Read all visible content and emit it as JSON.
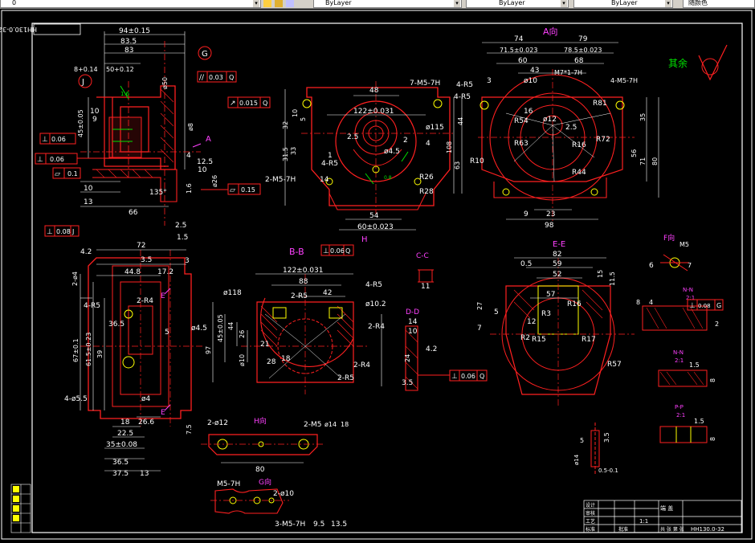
{
  "toolbar": {
    "layer_value": "0",
    "color_value": "ByLayer",
    "linetype_value": "ByLayer",
    "lineweight_value": "ByLayer",
    "plotstyle_value": "随颜色"
  },
  "colors": {
    "bg": "#000000",
    "outline": "#ff2020",
    "dim": "#ffffff",
    "center": "#ff3030",
    "green": "#00e000",
    "yellow": "#ffff00",
    "magenta": "#ff40ff",
    "hatch": "#ff2020"
  },
  "drawing": {
    "part_no_mirror": "HH130.0-32",
    "view_a": "A向",
    "view_b": "B-B",
    "view_cc": "C-C",
    "view_dd": "D-D",
    "view_ee": "E-E",
    "view_f": "F向",
    "view_h": "H向",
    "view_g": "G向",
    "view_nn": "N-N",
    "view_nn2": "N-N",
    "view_pp": "P-P",
    "scale_21a": "2:1",
    "scale_21b": "2:1",
    "scale_21c": "2:1",
    "qiyu": "其余",
    "tv": {
      "d1": "94±0.15",
      "d2": "83.5",
      "d3": "83",
      "d4": "8+0.14",
      "d5": "50+0.12",
      "d6": "10",
      "d7": "45±0.05",
      "d8": "9",
      "d9": "12.5",
      "d10": "4",
      "d11": "10",
      "d12": "13",
      "d13": "66",
      "d14": "135°",
      "d15": "1.6",
      "d16": "2.5",
      "d17": "1.5",
      "d18": "ø26",
      "d19": "ø50",
      "d20": "ø8",
      "d21": "10",
      "t1": "0.06",
      "t2": "0.06",
      "t3": "0.1",
      "t4": "0.03",
      "t5": "0.015",
      "t6": "0.15",
      "lbl_q": "Q",
      "lbl_j": "J",
      "lbl_g": "G",
      "lbl_a": "A"
    },
    "fv": {
      "d1": "48",
      "d2": "7-M5-7H",
      "d3": "4-R5",
      "d4": "122±0.031",
      "d5": "10",
      "d6": "5",
      "d7": "32",
      "d8": "31.5",
      "d9": "33",
      "d10": "ø115",
      "d11": "2.5",
      "d12": "ø4.5",
      "d13": "2",
      "d14": "4",
      "d15": "R26",
      "d16": "R28",
      "d17": "2-M5-7H",
      "d18": "54",
      "d19": "60±0.023",
      "d20": "14",
      "d21": "1",
      "d22": "4-R5"
    },
    "av": {
      "d1": "74",
      "d2": "79",
      "d3": "71.5±0.023",
      "d4": "78.5±0.023",
      "d5": "60",
      "d6": "68",
      "d7": "43",
      "d8": "ø10",
      "d9": "M7*1-7H",
      "d10": "4-R5",
      "d11": "4-M5-7H",
      "d12": "R81",
      "d13": "R54",
      "d14": "R63",
      "d15": "R16",
      "d16": "R72",
      "d17": "R10",
      "d18": "R44",
      "d19": "44",
      "d20": "108",
      "d21": "63",
      "d22": "56",
      "d23": "71",
      "d24": "80",
      "d25": "35",
      "d26": "23",
      "d27": "98",
      "d28": "9",
      "d29": "16",
      "d30": "ø12",
      "d31": "2.5",
      "d32": "3"
    },
    "bb": {
      "d1": "122±0.031",
      "d2": "88",
      "d3": "42",
      "d4": "2-R5",
      "d5": "4-R5",
      "d6": "ø118",
      "d7": "ø10.2",
      "d8": "45±0.05",
      "d9": "44",
      "d10": "26",
      "d11": "97",
      "d12": "21",
      "d13": "ø10",
      "d14": "28",
      "d15": "18",
      "d16": "2-R4",
      "d17": "2-R4",
      "d18": "2-R5",
      "d19": "0.06",
      "d20": "Q",
      "d21": "H"
    },
    "cc": {
      "d1": "11"
    },
    "dd": {
      "d1": "14",
      "d2": "10",
      "d3": "24",
      "d4": "4.2",
      "d5": "3.5",
      "d6": "0.06",
      "d7": "Q"
    },
    "ee": {
      "d1": "82",
      "d2": "59",
      "d3": "52",
      "d4": "0.5",
      "d5": "57",
      "d6": "R16",
      "d7": "R3",
      "d8": "12",
      "d9": "R2",
      "d10": "R15",
      "d11": "R17",
      "d12": "R57",
      "d13": "27",
      "d14": "7",
      "d15": "15",
      "d16": "11.5",
      "d17": "5"
    },
    "fd": {
      "d1": "6",
      "d2": "M5",
      "d3": "7"
    },
    "lv": {
      "d1": "0.08",
      "d2": "J",
      "d3": "4.2",
      "d4": "72",
      "d5": "3.5",
      "d6": "17.2",
      "d7": "44.8",
      "d8": "3",
      "d9": "2-R4",
      "d10": "4-R5",
      "d11": "5",
      "d12": "ø4.5",
      "d13": "36.5",
      "d14": "67±0.1",
      "d15": "61.5±0.23",
      "d16": "39",
      "d17": "4-ø5.5",
      "d18": "ø4",
      "d19": "18",
      "d20": "22.5",
      "d21": "35±0.08",
      "d22": "26.6",
      "d23": "36.5",
      "d24": "37.5",
      "d25": "13",
      "d26": "7.5",
      "d27": "2-ø4"
    },
    "hv": {
      "d1": "2-ø12",
      "d2": "2-M5",
      "d3": "80",
      "d4": "ø14",
      "d5": "18"
    },
    "gv": {
      "d1": "M5-7H",
      "d2": "2-ø10",
      "d3": "3-M5-7H",
      "d4": "9.5",
      "d5": "13.5"
    },
    "nn": {
      "d1": "8",
      "d2": "4",
      "d3": "0.08",
      "d4": "G",
      "d5": "1.5",
      "d6": "8",
      "d7": "2"
    },
    "pp": {
      "d1": "1.5",
      "d2": "8"
    },
    "sm": {
      "d1": "5",
      "d2": "3.5",
      "d3": "0.5-0.1",
      "d4": "ø14"
    },
    "title_block": {
      "name": "端 盖",
      "scale": "1:1",
      "sheet": "共 张 第 张",
      "code": "HH130.0-32",
      "lbl1": "设计",
      "lbl2": "审核",
      "lbl3": "工艺",
      "lbl4": "标准",
      "lbl5": "批准"
    }
  }
}
